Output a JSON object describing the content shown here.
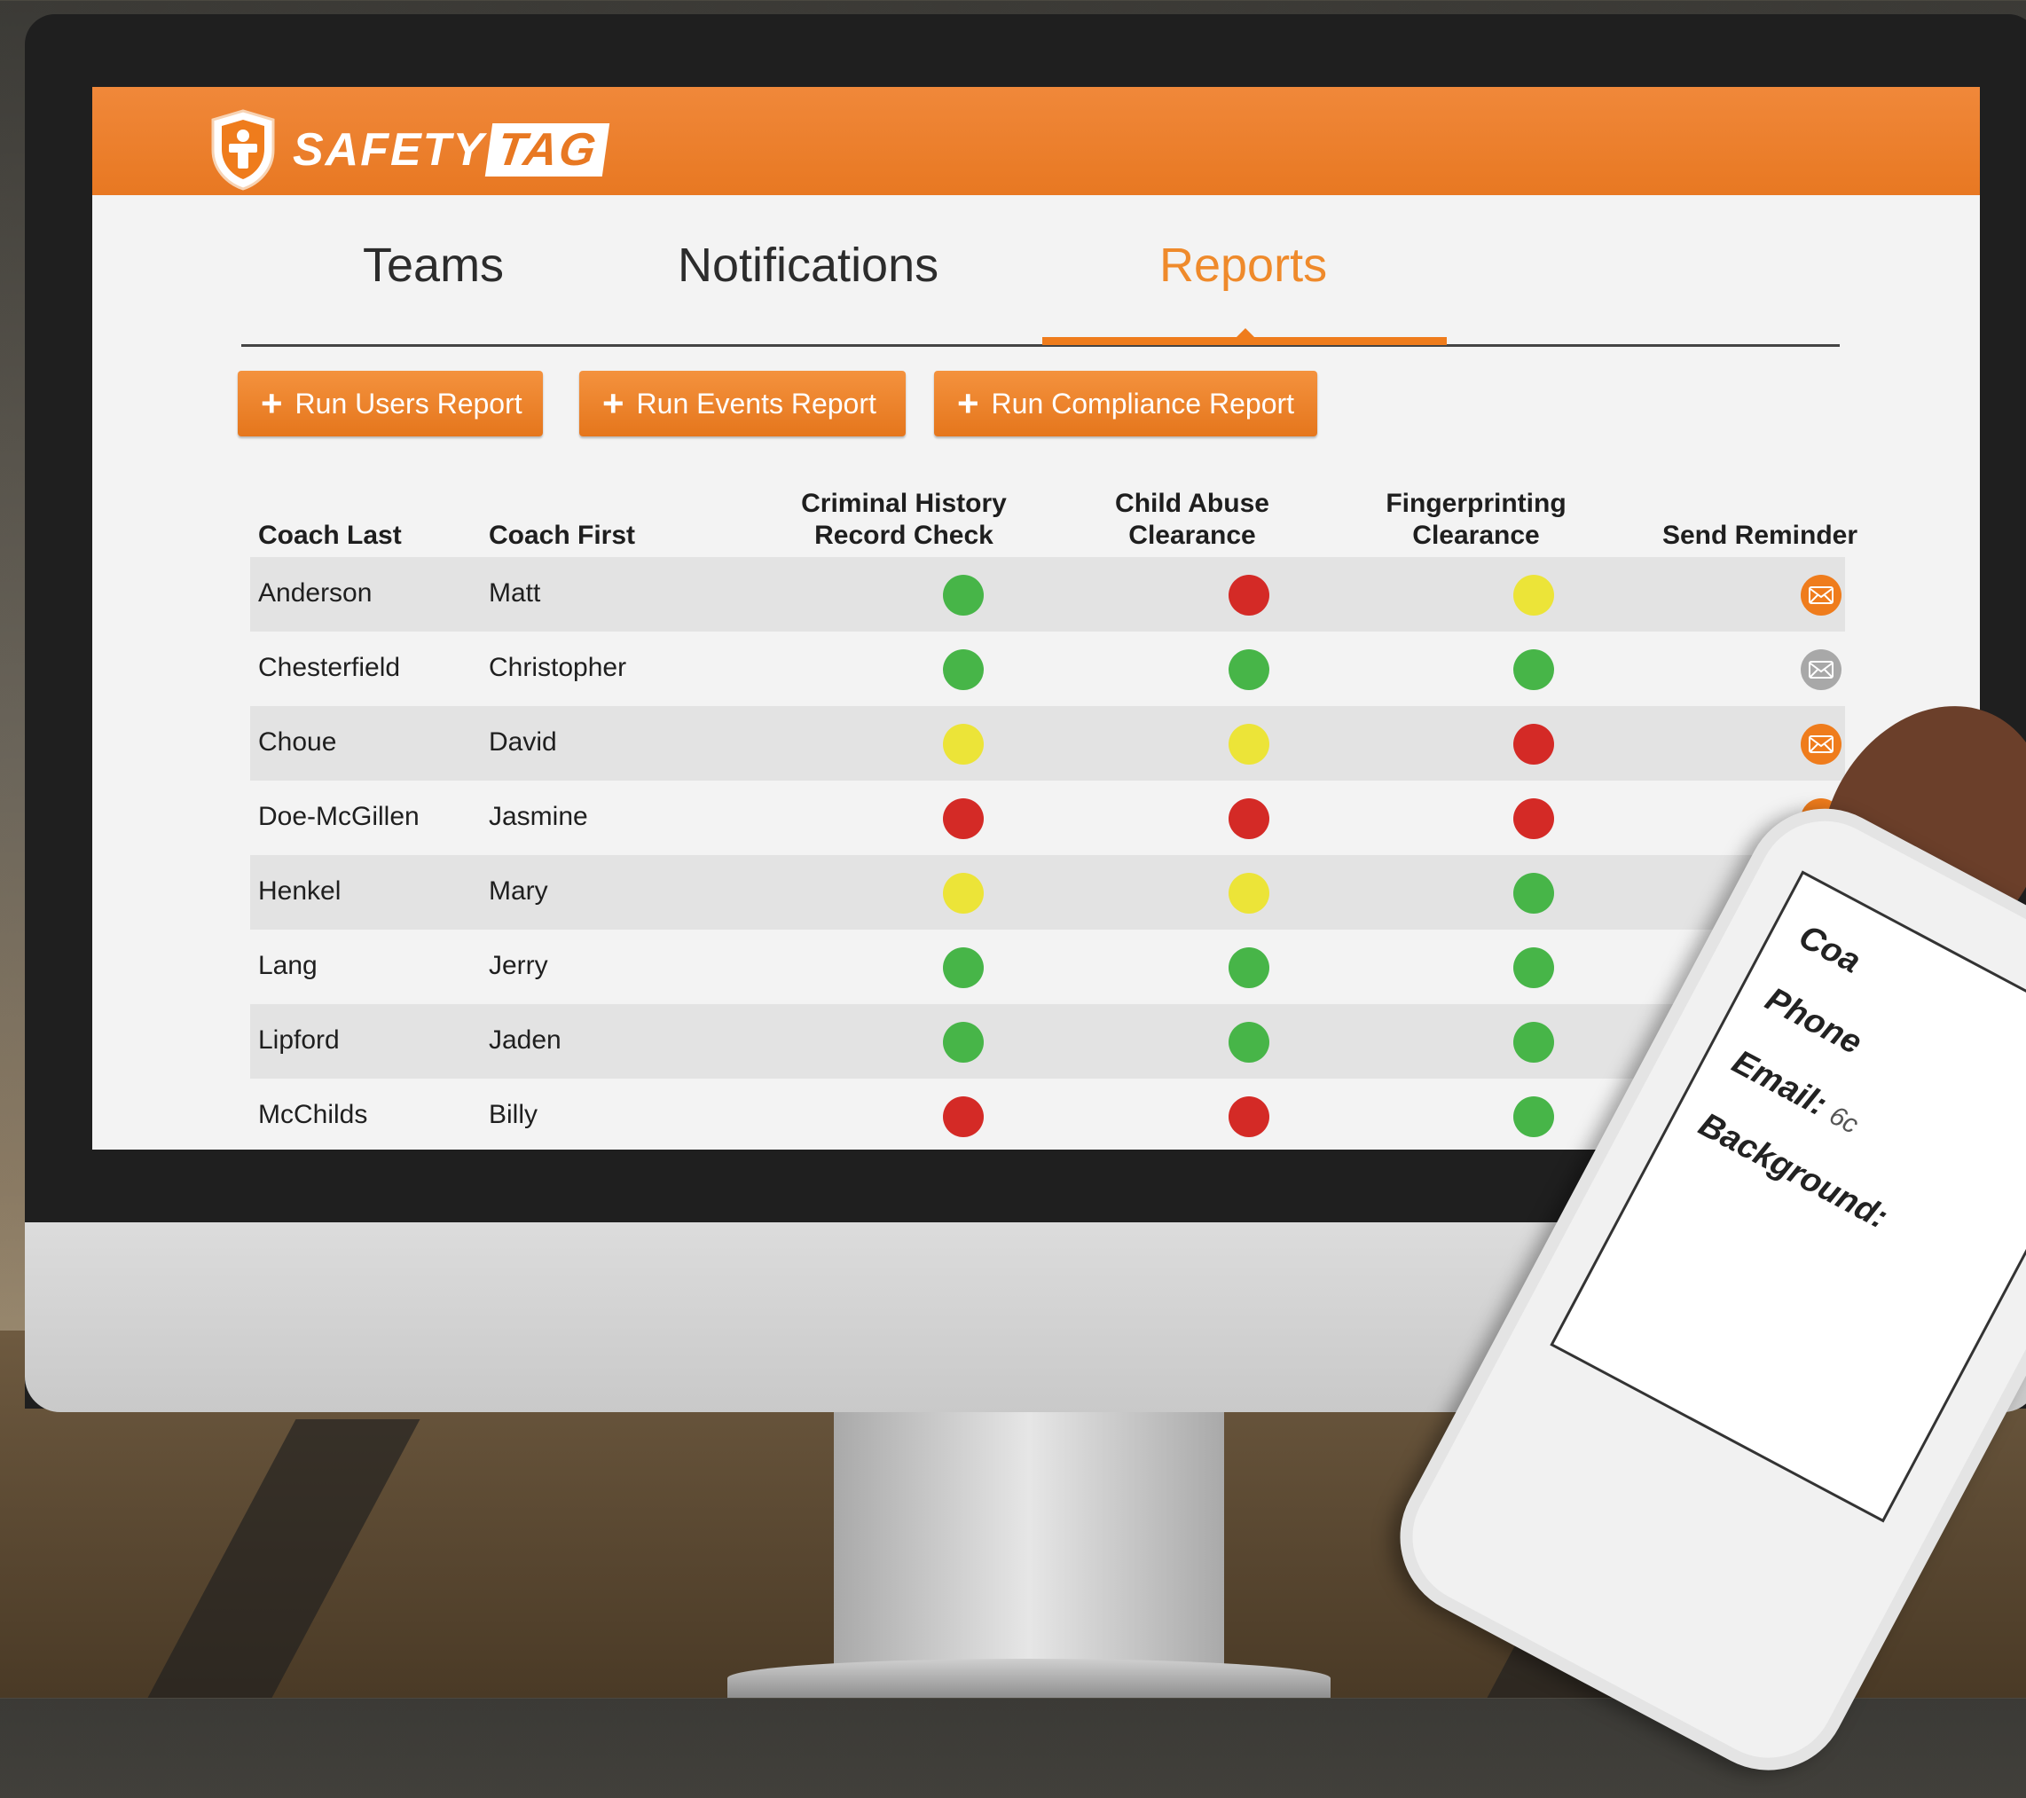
{
  "app": {
    "logo_text": "SAFETY",
    "logo_tag": "TAG"
  },
  "tabs": [
    {
      "label": "Teams",
      "active": false
    },
    {
      "label": "Notifications",
      "active": false
    },
    {
      "label": "Reports",
      "active": true
    }
  ],
  "actions": [
    {
      "label": "Run Users Report",
      "icon": "plus-icon"
    },
    {
      "label": "Run Events Report",
      "icon": "plus-icon"
    },
    {
      "label": "Run Compliance Report",
      "icon": "plus-icon"
    }
  ],
  "table": {
    "columns": [
      "Coach Last",
      "Coach First",
      "Criminal History",
      "Record Check",
      "Child Abuse",
      "Clearance",
      "Fingerprinting",
      "Clearance",
      "Send Reminder"
    ],
    "rows": [
      {
        "last": "Anderson",
        "first": "Matt",
        "criminal": "green",
        "abuse": "red",
        "fingerprint": "yellow",
        "reminder": "orange"
      },
      {
        "last": "Chesterfield",
        "first": "Christopher",
        "criminal": "green",
        "abuse": "green",
        "fingerprint": "green",
        "reminder": "gray"
      },
      {
        "last": "Choue",
        "first": "David",
        "criminal": "yellow",
        "abuse": "yellow",
        "fingerprint": "red",
        "reminder": "orange"
      },
      {
        "last": "Doe-McGillen",
        "first": "Jasmine",
        "criminal": "red",
        "abuse": "red",
        "fingerprint": "red",
        "reminder": "orange"
      },
      {
        "last": "Henkel",
        "first": "Mary",
        "criminal": "yellow",
        "abuse": "yellow",
        "fingerprint": "green",
        "reminder": "orange"
      },
      {
        "last": "Lang",
        "first": "Jerry",
        "criminal": "green",
        "abuse": "green",
        "fingerprint": "green",
        "reminder": "none"
      },
      {
        "last": "Lipford",
        "first": "Jaden",
        "criminal": "green",
        "abuse": "green",
        "fingerprint": "green",
        "reminder": "none"
      },
      {
        "last": "McChilds",
        "first": "Billy",
        "criminal": "red",
        "abuse": "red",
        "fingerprint": "green",
        "reminder": "orange"
      }
    ]
  },
  "phone": {
    "lines": [
      "Coa",
      "Phone",
      "Email:",
      "6c",
      "Background:"
    ]
  },
  "colors": {
    "accent": "#ef7c1c",
    "status_green": "#47b548",
    "status_red": "#d42a26",
    "status_yellow": "#ece438",
    "reminder_gray": "#a8a8a8"
  }
}
